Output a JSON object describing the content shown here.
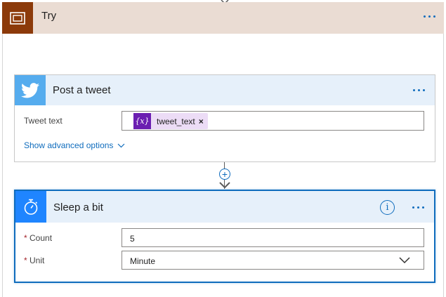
{
  "scope": {
    "title": "Try",
    "accent": "#8c3a0a",
    "header_bg": "#eadcd3",
    "icon": "scope-icon"
  },
  "tweet_action": {
    "title": "Post a tweet",
    "icon": "twitter-icon",
    "icon_bg": "#55acee",
    "fields": {
      "tweet_text_label": "Tweet text",
      "token_icon": "{x}",
      "token_label": "tweet_text",
      "token_remove": "×"
    },
    "advanced_link": "Show advanced options"
  },
  "connector": {
    "add_symbol": "+"
  },
  "sleep_action": {
    "title": "Sleep a bit",
    "icon": "timer-icon",
    "icon_bg": "#1f85ff",
    "info_symbol": "i",
    "fields": {
      "required_marker": "*",
      "count_label": "Count",
      "count_value": "5",
      "unit_label": "Unit",
      "unit_value": "Minute"
    }
  },
  "colors": {
    "link": "#0f6cbd",
    "card_header": "#e6f0fa",
    "token_bg": "#ecdcf6",
    "token_icon_bg": "#6b1fb1"
  }
}
